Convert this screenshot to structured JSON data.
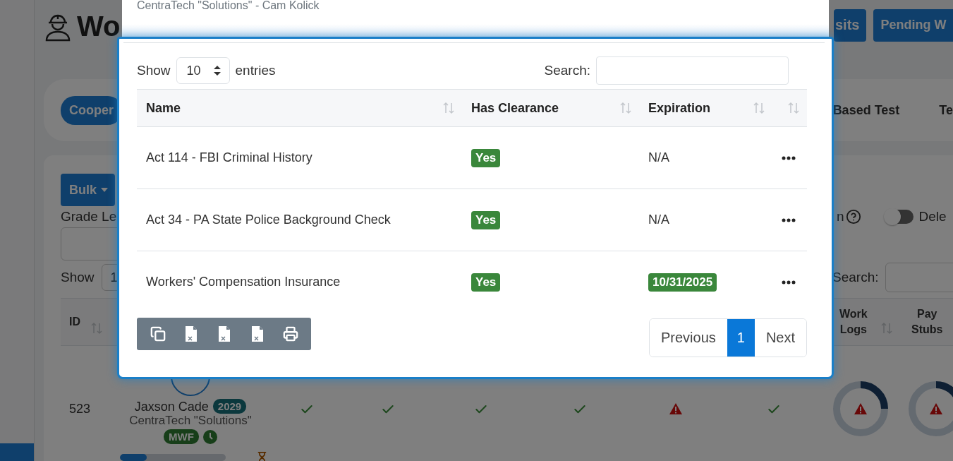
{
  "background": {
    "title": "Wo",
    "header_buttons": [
      "sits",
      "Pending W"
    ],
    "tabs": [
      {
        "label": "Cooper",
        "selected": true
      },
      {
        "label": "Based Test",
        "selected": false
      },
      {
        "label": "Te",
        "selected": false
      }
    ],
    "bulk_button": "Bulk",
    "filter_label": "Grade Le",
    "delete_toggle": {
      "label_before": "n",
      "label": "Dele",
      "on": false
    },
    "length": {
      "label": "Show",
      "value": "1"
    },
    "search_label": "Search:",
    "columns": [
      "ID",
      "Work Logs",
      "Pay Stubs"
    ],
    "row": {
      "id": "523",
      "name": "Jaxson Cade",
      "year": "2029",
      "company": "CentraTech \"Solutions\"",
      "schedule": "MWF",
      "progress": {
        "level": 0.25
      },
      "statuses": [
        {
          "kind": "check"
        },
        {
          "kind": "check"
        },
        {
          "kind": "check"
        },
        {
          "kind": "check"
        },
        {
          "kind": "warning"
        },
        {
          "kind": "check"
        }
      ],
      "rings": [
        {
          "level": 0.25,
          "kind": "warning"
        },
        {
          "level": 0.2,
          "kind": "warning"
        }
      ]
    }
  },
  "modal": {
    "title": "CentraTech \"Solutions\" - Cam Kolick",
    "length": {
      "label_before": "Show",
      "value": "10",
      "label_after": "entries"
    },
    "search": {
      "label": "Search:"
    },
    "columns": [
      "Name",
      "Has Clearance",
      "Expiration"
    ],
    "rows": [
      {
        "name": "Act 114 - FBI Criminal History",
        "clearance": "Yes",
        "expiration": {
          "text": "N/A",
          "kind": "plain"
        }
      },
      {
        "name": "Act 34 - PA State Police Background Check",
        "clearance": "Yes",
        "expiration": {
          "text": "N/A",
          "kind": "plain"
        }
      },
      {
        "name": "Workers' Compensation Insurance",
        "clearance": "Yes",
        "expiration": {
          "text": "10/31/2025",
          "kind": "badge"
        }
      }
    ],
    "export_buttons": [
      {
        "kind": "copy"
      },
      {
        "kind": "excel"
      },
      {
        "kind": "csv"
      },
      {
        "kind": "pdf"
      },
      {
        "kind": "print"
      }
    ],
    "pagination": [
      {
        "label": "Previous",
        "selected": false
      },
      {
        "label": "1",
        "selected": true
      },
      {
        "label": "Next",
        "selected": false
      }
    ]
  }
}
